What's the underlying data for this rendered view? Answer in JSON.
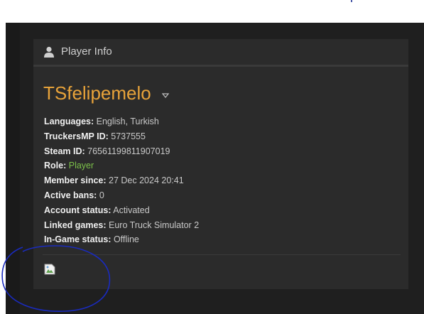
{
  "header": {
    "title": "Player Info",
    "icon": "user-icon"
  },
  "player": {
    "username": "TSfelipemelo",
    "rows": [
      {
        "label": "Languages:",
        "value": "English, Turkish"
      },
      {
        "label": "TruckersMP ID:",
        "value": "5737555"
      },
      {
        "label": "Steam ID:",
        "value": "76561199811907019"
      },
      {
        "label": "Role:",
        "value": "Player"
      },
      {
        "label": "Member since:",
        "value": "27 Dec 2024 20:41"
      },
      {
        "label": "Active bans:",
        "value": "0"
      },
      {
        "label": "Account status:",
        "value": "Activated"
      },
      {
        "label": "Linked games:",
        "value": "Euro Truck Simulator 2"
      },
      {
        "label": "In-Game status:",
        "value": "Offline"
      }
    ]
  },
  "colors": {
    "username": "#e8a33a",
    "role": "#7cc14a",
    "annotation_circle": "#1a2bbf"
  }
}
